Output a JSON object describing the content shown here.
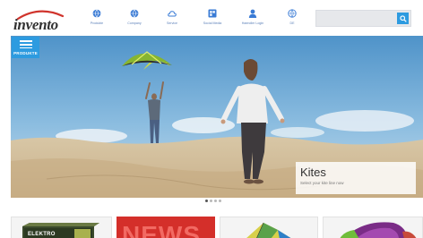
{
  "header": {
    "logo_text": "invento",
    "nav": [
      {
        "label": "Produkte",
        "icon": "globe-icon"
      },
      {
        "label": "Company",
        "icon": "globe-icon"
      },
      {
        "label": "Service",
        "icon": "cloud-icon"
      },
      {
        "label": "Social Media",
        "icon": "social-icon"
      },
      {
        "label": "Haendler Login",
        "icon": "user-icon"
      },
      {
        "label": "DE",
        "icon": "language-icon"
      }
    ],
    "search": {
      "placeholder": ""
    }
  },
  "hero": {
    "products_label": "PRODUKTE",
    "caption_title": "Kites",
    "caption_subtitle": "Select your kite line now"
  },
  "slider": {
    "dot_count": 4,
    "active_index": 0
  },
  "tiles": [
    {
      "label": "ELEKTRO",
      "kind": "product-box"
    },
    {
      "label": "NEWS",
      "kind": "news"
    },
    {
      "label": "",
      "kind": "kite"
    },
    {
      "label": "",
      "kind": "kite"
    }
  ],
  "colors": {
    "accent": "#2d9be0",
    "news_red": "#d42f2a",
    "logo_red": "#d0342c",
    "nav_blue": "#3a7bd5"
  }
}
